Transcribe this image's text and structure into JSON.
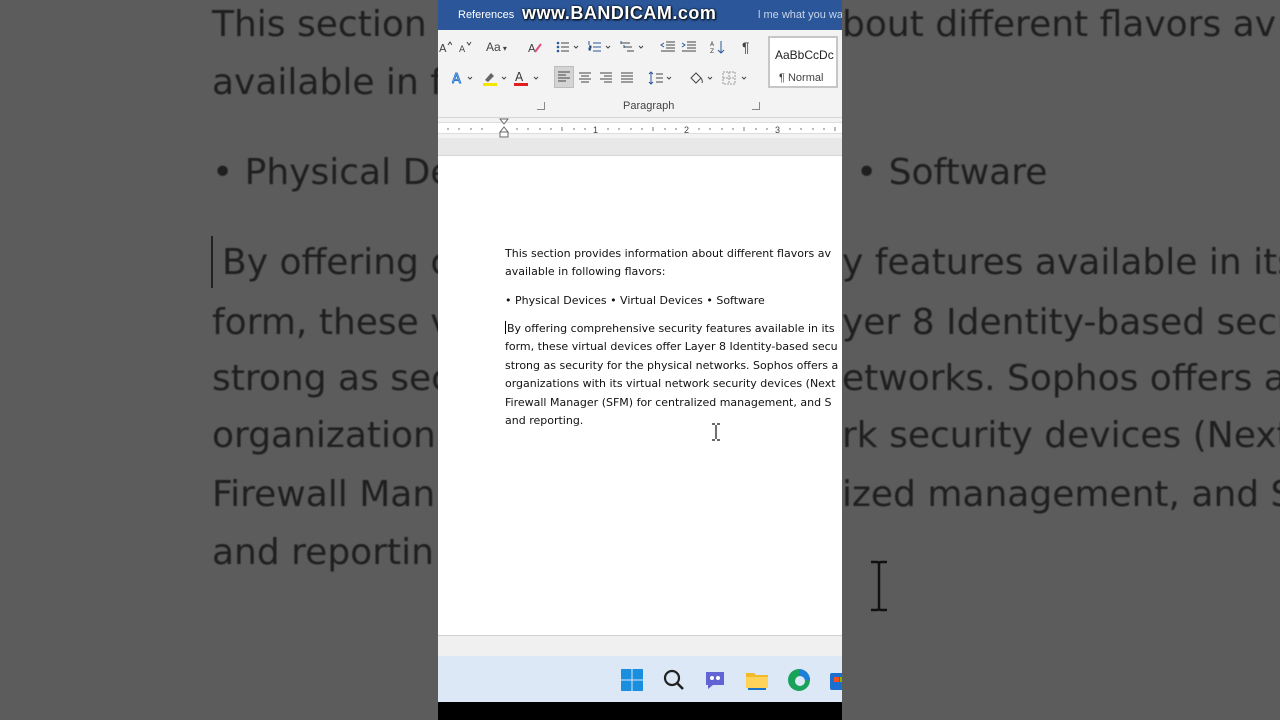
{
  "background_zoom": {
    "line1": "This section",
    "line1b": "bout different flavors av",
    "line2": "available in f",
    "bullets_left": "• Physical De",
    "bullets_right": "• Software",
    "p_lines": [
      {
        "left": "By offering c",
        "right": "y features available in its"
      },
      {
        "left": "form, these v",
        "right": "yer 8 Identity-based secu"
      },
      {
        "left": "strong as sec",
        "right": "etworks. Sophos offers a"
      },
      {
        "left": "organization:",
        "right": "rk security devices (Next"
      },
      {
        "left": "Firewall Man",
        "right": "ized management, and S"
      },
      {
        "left": "and reportin",
        "right": ""
      }
    ]
  },
  "titlebar": {
    "tab_label": "References",
    "watermark": "www.BANDICAM.com",
    "tell_me": "l me what you wa"
  },
  "ribbon": {
    "font_case_label": "Aa",
    "paragraph_group_label": "Paragraph",
    "pilcrow": "¶",
    "style_sample": "AaBbCcDc",
    "style_name": "¶ Normal"
  },
  "ruler": {
    "numbers": [
      "1",
      "2",
      "3"
    ]
  },
  "document": {
    "para1_line1": "This section provides information about different flavors av",
    "para1_line2": "available in following flavors:",
    "bullets": "• Physical Devices • Virtual Devices • Software",
    "para3_lines": [
      "By offering comprehensive security features available in its",
      "form, these virtual devices offer Layer 8 Identity-based secu",
      "strong as security for the physical networks. Sophos offers a",
      "organizations with its virtual network security devices (Next",
      "Firewall Manager (SFM) for centralized management, and S",
      "and reporting."
    ]
  },
  "taskbar": {
    "icons": [
      "windows-start-icon",
      "search-icon",
      "chat-icon",
      "file-explorer-icon",
      "edge-icon",
      "store-icon"
    ]
  },
  "colors": {
    "word_blue": "#2b579a",
    "taskbar": "#dde8f6"
  }
}
